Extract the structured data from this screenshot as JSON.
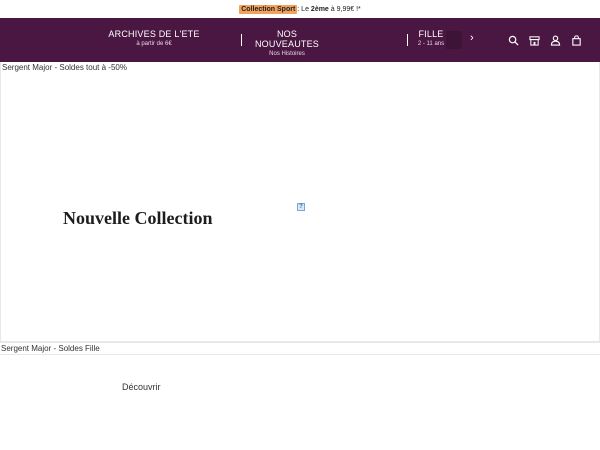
{
  "promo": {
    "highlight": "Collection Sport",
    "separator": " : Le ",
    "bold": "2ème",
    "rest": " à 9,99€ !*"
  },
  "nav": {
    "items": [
      {
        "main": "ARCHIVES DE L'ETE",
        "sub": "à partir de 6€"
      },
      {
        "main": "NOS NOUVEAUTES",
        "sub": "Nos Histoires"
      },
      {
        "main": "FILLE",
        "sub": "2 - 11 ans"
      }
    ],
    "next_arrow": "›",
    "icons": [
      "search-icon",
      "store-icon",
      "account-icon",
      "bag-icon"
    ]
  },
  "hero": {
    "label": "Sergent Major - Soldes tout à -50%",
    "title": "Nouvelle Collection",
    "broken_image_glyph": "?"
  },
  "section2": {
    "label": "Sergent Major - Soldes Fille",
    "cta": "Découvrir"
  },
  "colors": {
    "nav_background": "#4a1742",
    "promo_highlight": "#f2a25c"
  }
}
